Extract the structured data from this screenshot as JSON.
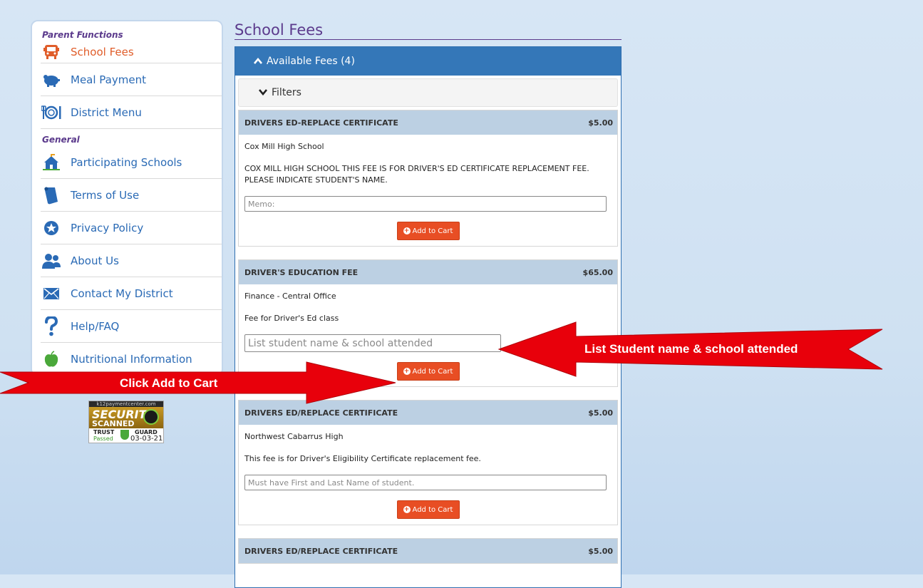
{
  "sidebar": {
    "heading_parent": "Parent Functions",
    "heading_general": "General",
    "items": [
      {
        "label": "School Fees"
      },
      {
        "label": "Meal Payment"
      },
      {
        "label": "District Menu"
      },
      {
        "label": "Participating Schools"
      },
      {
        "label": "Terms of Use"
      },
      {
        "label": "Privacy Policy"
      },
      {
        "label": "About Us"
      },
      {
        "label": "Contact My District"
      },
      {
        "label": "Help/FAQ"
      },
      {
        "label": "Nutritional Information"
      }
    ]
  },
  "badge": {
    "site": "k12paymentcenter.com",
    "line1": "SECURITY",
    "line2": "SCANNED",
    "trust": "TRUST",
    "guard": "GUARD",
    "status": "Passed",
    "date": "03-03-21"
  },
  "page": {
    "title": "School Fees",
    "panel_header": "Available Fees (4)",
    "filters_label": "Filters"
  },
  "fees": [
    {
      "name": "DRIVERS ED-REPLACE CERTIFICATE",
      "price": "$5.00",
      "school": "Cox Mill High School",
      "description": "COX MILL HIGH SCHOOL THIS FEE IS FOR DRIVER'S ED CERTIFICATE REPLACEMENT FEE. PLEASE INDICATE STUDENT'S NAME.",
      "memo_placeholder": "Memo:",
      "button": "Add to Cart"
    },
    {
      "name": "DRIVER'S EDUCATION FEE",
      "price": "$65.00",
      "school": "Finance - Central Office",
      "description": "Fee for Driver's Ed class",
      "memo_placeholder": "List student name & school attended",
      "button": "Add to Cart"
    },
    {
      "name": "DRIVERS ED/REPLACE CERTIFICATE",
      "price": "$5.00",
      "school": "Northwest Cabarrus High",
      "description": "This fee is for Driver's Eligibility Certificate replacement fee.",
      "memo_placeholder": "Must have First and Last Name of student.",
      "button": "Add to Cart"
    },
    {
      "name": "DRIVERS ED/REPLACE CERTIFICATE",
      "price": "$5.00"
    }
  ],
  "annotations": {
    "left_arrow": "Click Add to Cart",
    "right_arrow": "List Student name & school attended"
  },
  "colors": {
    "accent_blue": "#3477b8",
    "title_purple": "#5b3a8c",
    "link_blue": "#2a6ab5",
    "active_orange": "#e05d2a",
    "button_orange": "#e84e24",
    "arrow_red": "#e8000b"
  }
}
